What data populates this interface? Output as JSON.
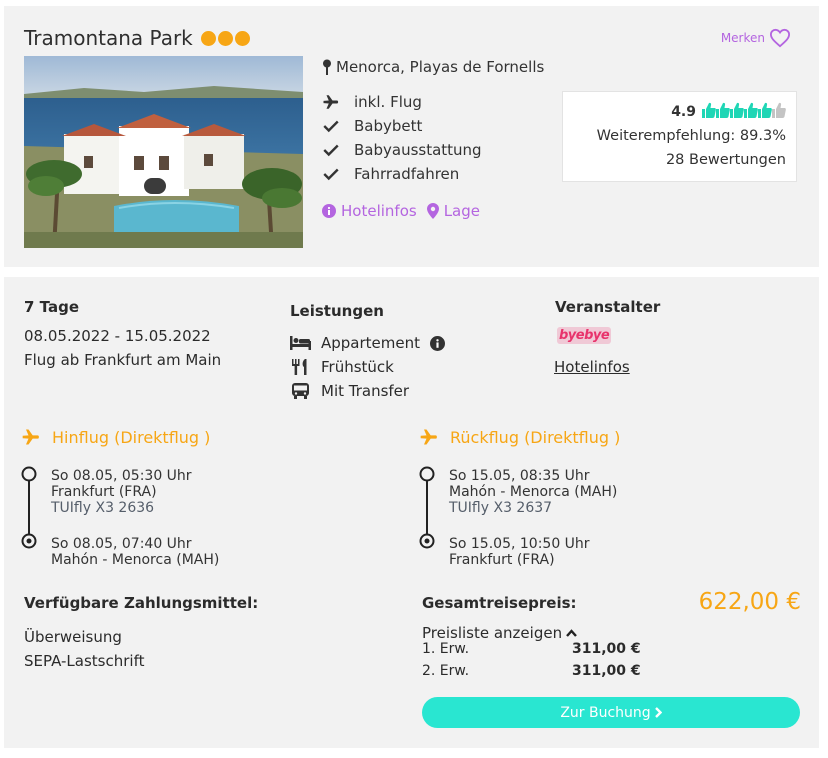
{
  "hotel": {
    "name": "Tramontana Park",
    "stars": 3,
    "merken_label": "Merken",
    "location": "Menorca, Playas de Fornells",
    "features": [
      "inkl. Flug",
      "Babybett",
      "Babyausstattung",
      "Fahrradfahren"
    ],
    "links": {
      "hotelinfos": "Hotelinfos",
      "lage": "Lage"
    },
    "rating": {
      "score": "4.9",
      "thumbs_full": 5,
      "thumbs_total": 6,
      "recommendation": "Weiterempfehlung: 89.3%",
      "reviews": "28 Bewertungen"
    }
  },
  "offer": {
    "duration": "7 Tage",
    "dates": "08.05.2022 - 15.05.2022",
    "departure": "Flug ab Frankfurt am Main",
    "services": {
      "heading": "Leistungen",
      "items": [
        "Appartement",
        "Frühstück",
        "Mit Transfer"
      ]
    },
    "operator": {
      "heading": "Veranstalter",
      "logo_text": "byebye",
      "link": "Hotelinfos"
    },
    "outbound": {
      "heading": "Hinflug (Direktflug )",
      "dep_time": "So 08.05, 05:30 Uhr",
      "dep_airport": "Frankfurt (FRA)",
      "flight": "TUIfly X3 2636",
      "arr_time": "So 08.05, 07:40 Uhr",
      "arr_airport": "Mahón - Menorca (MAH)"
    },
    "return": {
      "heading": "Rückflug (Direktflug )",
      "dep_time": "So 15.05, 08:35 Uhr",
      "dep_airport": "Mahón - Menorca (MAH)",
      "flight": "TUIfly X3 2637",
      "arr_time": "So 15.05, 10:50 Uhr",
      "arr_airport": "Frankfurt (FRA)"
    },
    "payment": {
      "heading": "Verfügbare Zahlungsmittel:",
      "methods": [
        "Überweisung",
        "SEPA-Lastschrift"
      ]
    },
    "pricing": {
      "heading": "Gesamtreisepreis:",
      "total": "622,00 €",
      "toggle_label": "Preisliste anzeigen",
      "lines": [
        {
          "label": "1. Erw.",
          "amount": "311,00 €"
        },
        {
          "label": "2. Erw.",
          "amount": "311,00 €"
        }
      ]
    },
    "book_button": "Zur Buchung"
  },
  "colors": {
    "accent_orange": "#f7a615",
    "link_purple": "#b465e0",
    "rating_green": "#1fd6b5",
    "button_turquoise": "#29e6d1"
  }
}
